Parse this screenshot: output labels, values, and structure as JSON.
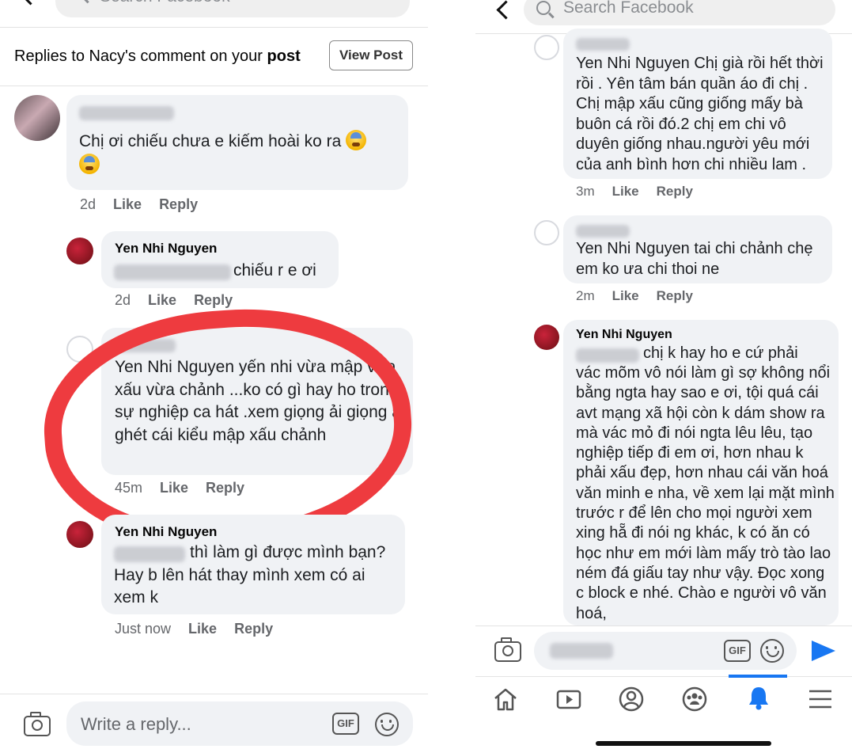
{
  "left": {
    "search_placeholder": "Search Facebook",
    "header": {
      "title_prefix": "Replies to Nacy's comment on your ",
      "title_bold": "post",
      "view_post": "View Post"
    },
    "comments": [
      {
        "text": "Chị ơi chiếu chưa e kiếm hoài ko ra",
        "time": "2d",
        "like": "Like",
        "reply": "Reply"
      },
      {
        "name": "Yen Nhi Nguyen",
        "text": "chiếu r e ơi",
        "time": "2d",
        "like": "Like",
        "reply": "Reply"
      },
      {
        "text": "Yen Nhi Nguyen  yến nhi vừa mập vừa xấu vừa chảnh ...ko có gì hay ho trong sự nghiệp ca hát .xem giọng ải giọng ai ghét cái kiểu mập xấu chảnh",
        "time": "45m",
        "like": "Like",
        "reply": "Reply"
      },
      {
        "name": "Yen Nhi Nguyen",
        "text": "thì làm gì được mình bạn? Hay b lên hát thay mình xem có ai xem k",
        "time": "Just now",
        "like": "Like",
        "reply": "Reply"
      }
    ],
    "composer_placeholder": "Write a reply..."
  },
  "right": {
    "search_placeholder": "Search Facebook",
    "comments": [
      {
        "text": "Yen Nhi Nguyen Chị già rồi hết thời rồi . Yên tâm bán quần áo đi chị . Chị mập xấu cũng giống mấy bà buôn cá rồi đó.2 chị em chi vô duyên giống nhau.người yêu mới của anh bình hơn chi nhiều lam .",
        "time": "3m",
        "like": "Like",
        "reply": "Reply"
      },
      {
        "text": "Yen Nhi Nguyen tai chi chảnh chẹ em ko ưa chi thoi ne",
        "time": "2m",
        "like": "Like",
        "reply": "Reply"
      },
      {
        "name": "Yen Nhi Nguyen",
        "text_first": "chị k hay ho e cứ phải",
        "text": "vác mõm vô nói làm gì sợ không nổi bằng ngta hay sao e ơi, tội quá cái avt mạng xã hội còn k dám show ra mà vác mỏ đi nói ngta lêu lêu, tạo nghiệp tiếp đi em ơi, hơn nhau k phải xấu đẹp, hơn nhau cái văn hoá văn minh e nha, về xem lại mặt mình trước r để lên cho mọi người xem xing hẵ đi nói ng khác, k có ăn có học như em mới làm mấy trò tào lao ném đá giấu tay như vậy. Đọc xong c block e nhé. Chào e người vô văn hoá,"
      }
    ]
  },
  "colors": {
    "bubble": "#f0f2f5",
    "accent": "#1877f2",
    "annotation": "#ee3b3f"
  }
}
